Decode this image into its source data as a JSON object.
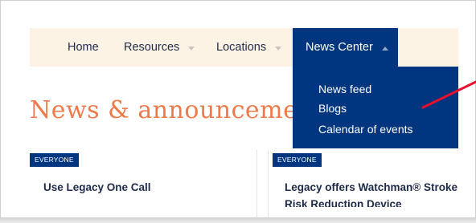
{
  "nav": {
    "home": "Home",
    "resources": "Resources",
    "locations": "Locations",
    "news_center": "News Center"
  },
  "dropdown": {
    "items": [
      "News feed",
      "Blogs",
      "Calendar of events"
    ]
  },
  "page": {
    "heading": "News & announcements"
  },
  "cards": [
    {
      "badge": "EVERYONE",
      "title": "Use Legacy One Call"
    },
    {
      "badge": "EVERYONE",
      "title": "Legacy offers Watchman® Stroke",
      "title_line2": "Risk Reduction Device"
    }
  ],
  "colors": {
    "navy": "#00357f",
    "nav_bg": "#fdf3e4",
    "heading_orange": "#ee7a4a",
    "annotation_red": "#e8102a"
  },
  "icons": {
    "dropdown_closed": "chevron-down-icon",
    "dropdown_open": "chevron-up-icon"
  }
}
